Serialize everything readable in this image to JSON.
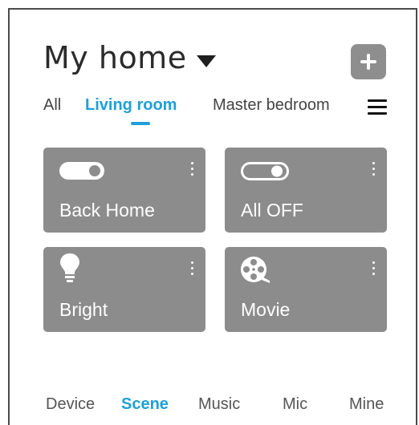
{
  "header": {
    "title": "My home"
  },
  "tabs": [
    {
      "label": "All"
    },
    {
      "label": "Living room",
      "active": true
    },
    {
      "label": "Master bedroom"
    }
  ],
  "scenes": [
    {
      "label": "Back Home",
      "icon": "toggle-on-icon"
    },
    {
      "label": "All OFF",
      "icon": "toggle-off-icon"
    },
    {
      "label": "Bright",
      "icon": "lightbulb-icon"
    },
    {
      "label": "Movie",
      "icon": "film-reel-icon"
    }
  ],
  "bottom_nav": [
    {
      "label": "Device"
    },
    {
      "label": "Scene",
      "active": true
    },
    {
      "label": "Music"
    },
    {
      "label": "Mic"
    },
    {
      "label": "Mine"
    }
  ],
  "colors": {
    "accent": "#1ea0d8",
    "card": "#8c8c8c",
    "add_button": "#8e8e8e"
  }
}
